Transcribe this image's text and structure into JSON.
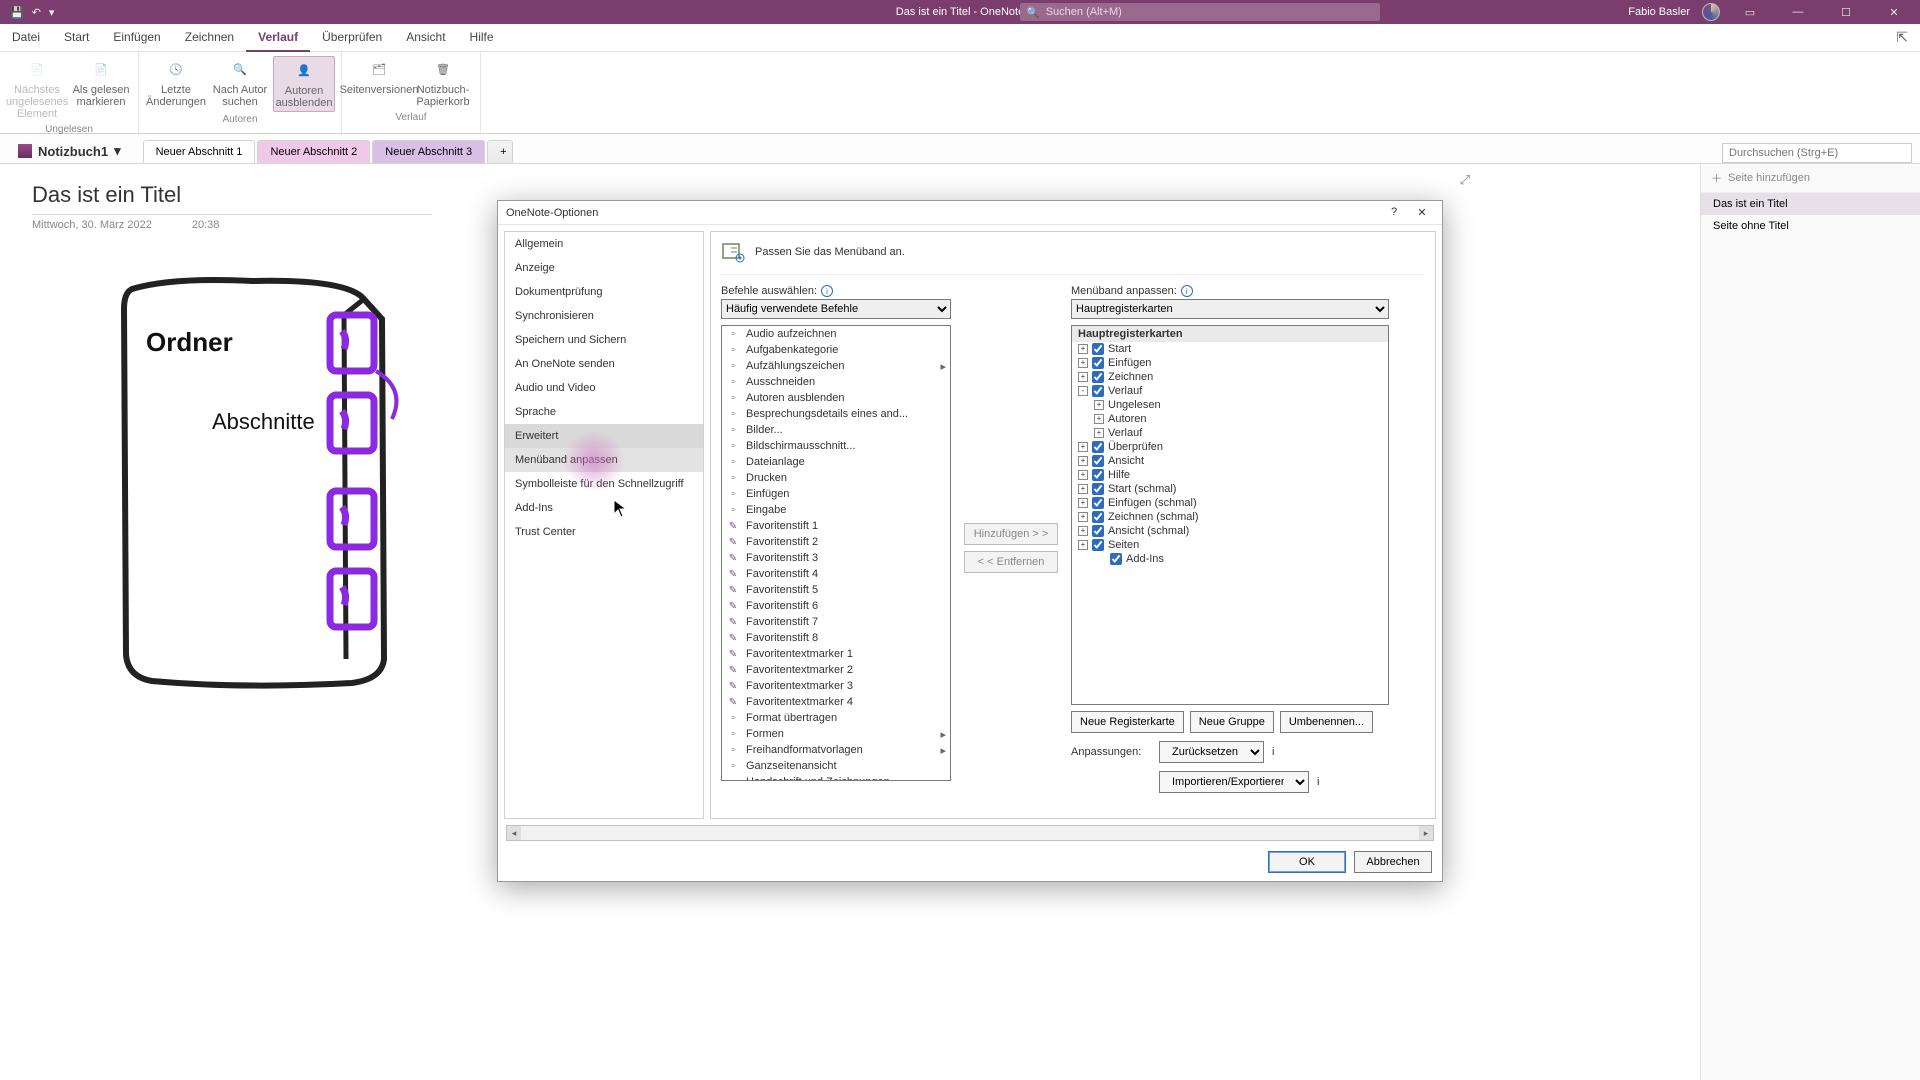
{
  "titlebar": {
    "title": "Das ist ein Titel  -  OneNote",
    "search_placeholder": "Suchen (Alt+M)",
    "user": "Fabio Basler"
  },
  "menu": {
    "tabs": [
      "Datei",
      "Start",
      "Einfügen",
      "Zeichnen",
      "Verlauf",
      "Überprüfen",
      "Ansicht",
      "Hilfe"
    ],
    "active": 4
  },
  "ribbon": {
    "group_ungelesen": {
      "label": "Ungelesen",
      "b0": "Nächstes\nungelesenes Element",
      "b1": "Als gelesen\nmarkieren"
    },
    "group_autoren": {
      "label": "Autoren",
      "b0": "Letzte\nÄnderungen",
      "b1": "Nach Autor\nsuchen",
      "b2": "Autoren\nausblenden"
    },
    "group_verlauf": {
      "label": "Verlauf",
      "b0": "Seitenversionen",
      "b1": "Notizbuch-\nPapierkorb"
    }
  },
  "notebook": {
    "name": "Notizbuch1",
    "tabs": [
      "Neuer Abschnitt 1",
      "Neuer Abschnitt 2",
      "Neuer Abschnitt 3"
    ],
    "search_placeholder": "Durchsuchen (Strg+E)"
  },
  "page": {
    "title": "Das ist ein Titel",
    "date": "Mittwoch, 30. März 2022",
    "time": "20:38",
    "sketch": {
      "label1": "Ordner",
      "label2": "Abschnitte"
    }
  },
  "rpane": {
    "add": "Seite hinzufügen",
    "p0": "Das ist ein Titel",
    "p1": "Seite ohne Titel"
  },
  "dialog": {
    "title": "OneNote-Optionen",
    "cats": [
      "Allgemein",
      "Anzeige",
      "Dokumentprüfung",
      "Synchronisieren",
      "Speichern und Sichern",
      "An OneNote senden",
      "Audio und Video",
      "Sprache",
      "Erweitert",
      "Menüband anpassen",
      "Symbolleiste für den Schnellzugriff",
      "Add-Ins",
      "Trust Center"
    ],
    "cat_active": 9,
    "header": "Passen Sie das Menüband an.",
    "left_label": "Befehle auswählen:",
    "left_combo": "Häufig verwendete Befehle",
    "right_label": "Menüband anpassen:",
    "right_combo": "Hauptregisterkarten",
    "btn_add": "Hinzufügen > >",
    "btn_remove": "< < Entfernen",
    "cmds": [
      "Audio aufzeichnen",
      "Aufgabenkategorie",
      "Aufzählungszeichen",
      "Ausschneiden",
      "Autoren ausblenden",
      "Besprechungsdetails eines and...",
      "Bilder...",
      "Bildschirmausschnitt...",
      "Dateianlage",
      "Drucken",
      "Einfügen",
      "Eingabe",
      "Favoritenstift 1",
      "Favoritenstift 2",
      "Favoritenstift 3",
      "Favoritenstift 4",
      "Favoritenstift 5",
      "Favoritenstift 6",
      "Favoritenstift 7",
      "Favoritenstift 8",
      "Favoritentextmarker 1",
      "Favoritentextmarker 2",
      "Favoritentextmarker 3",
      "Favoritentextmarker 4",
      "Format übertragen",
      "Formen",
      "Freihandformatvorlagen",
      "Ganzseitenansicht",
      "Handschrift und Zeichnungen ..."
    ],
    "cmd_flyout": {
      "2": true,
      "25": true,
      "26": true
    },
    "tree_header": "Hauptregisterkarten",
    "tree": [
      {
        "lvl": 0,
        "exp": "+",
        "chk": true,
        "label": "Start"
      },
      {
        "lvl": 0,
        "exp": "+",
        "chk": true,
        "label": "Einfügen"
      },
      {
        "lvl": 0,
        "exp": "+",
        "chk": true,
        "label": "Zeichnen"
      },
      {
        "lvl": 0,
        "exp": "-",
        "chk": true,
        "label": "Verlauf"
      },
      {
        "lvl": 1,
        "exp": "+",
        "chk": null,
        "label": "Ungelesen"
      },
      {
        "lvl": 1,
        "exp": "+",
        "chk": null,
        "label": "Autoren"
      },
      {
        "lvl": 1,
        "exp": "+",
        "chk": null,
        "label": "Verlauf"
      },
      {
        "lvl": 0,
        "exp": "+",
        "chk": true,
        "label": "Überprüfen"
      },
      {
        "lvl": 0,
        "exp": "+",
        "chk": true,
        "label": "Ansicht"
      },
      {
        "lvl": 0,
        "exp": "+",
        "chk": true,
        "label": "Hilfe"
      },
      {
        "lvl": 0,
        "exp": "+",
        "chk": true,
        "label": "Start (schmal)"
      },
      {
        "lvl": 0,
        "exp": "+",
        "chk": true,
        "label": "Einfügen (schmal)"
      },
      {
        "lvl": 0,
        "exp": "+",
        "chk": true,
        "label": "Zeichnen (schmal)"
      },
      {
        "lvl": 0,
        "exp": "+",
        "chk": true,
        "label": "Ansicht (schmal)"
      },
      {
        "lvl": 0,
        "exp": "+",
        "chk": true,
        "label": "Seiten"
      },
      {
        "lvl": 1,
        "exp": "",
        "chk": true,
        "label": "Add-Ins"
      }
    ],
    "btn_newtab": "Neue Registerkarte",
    "btn_newgroup": "Neue Gruppe",
    "btn_rename": "Umbenennen...",
    "anpass_label": "Anpassungen:",
    "btn_reset": "Zurücksetzen",
    "btn_impexp": "Importieren/Exportieren",
    "ok": "OK",
    "cancel": "Abbrechen"
  }
}
